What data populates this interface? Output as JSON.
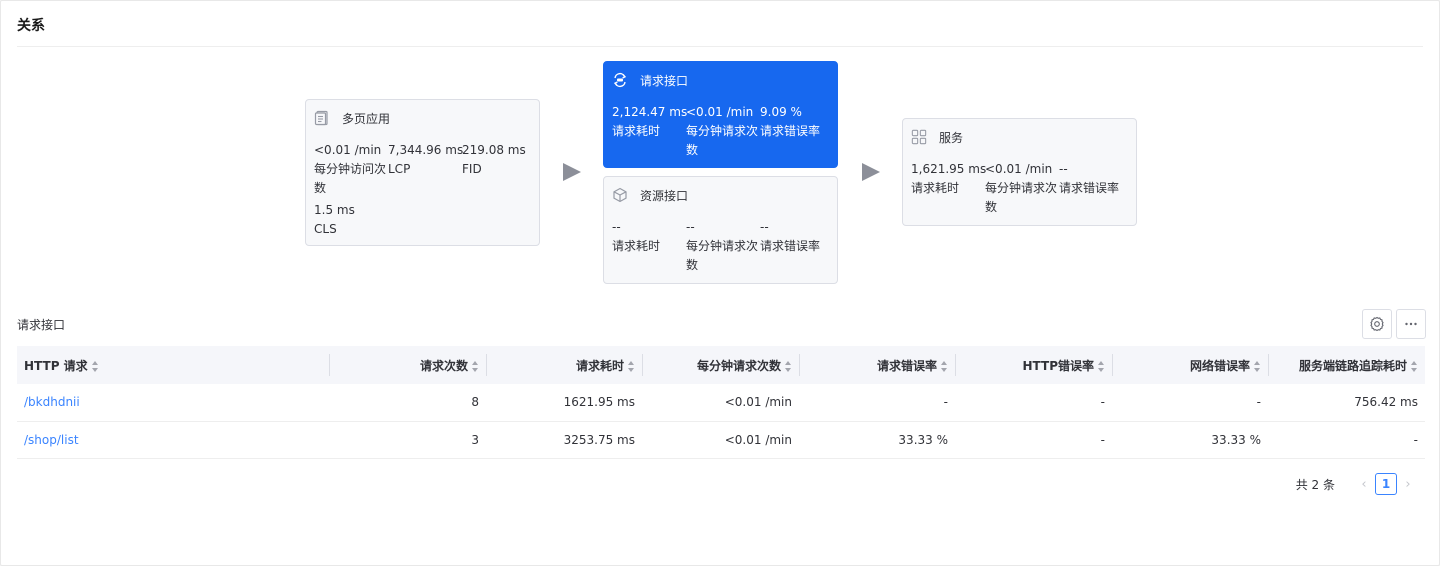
{
  "section_title": "关系",
  "cards": {
    "app": {
      "title": "多页应用",
      "icon": "document-icon",
      "metrics": [
        {
          "value": "<0.01 /min",
          "label": "每分钟访问次数"
        },
        {
          "value": "7,344.96 ms",
          "label": "LCP"
        },
        {
          "value": "219.08 ms",
          "label": "FID"
        },
        {
          "value": "1.5 ms",
          "label": "CLS"
        }
      ]
    },
    "request": {
      "title": "请求接口",
      "icon": "api-exchange-icon",
      "active": true,
      "metrics": [
        {
          "value": "2,124.47 ms",
          "label": "请求耗时"
        },
        {
          "value": "<0.01 /min",
          "label": "每分钟请求次数"
        },
        {
          "value": "9.09 %",
          "label": "请求错误率"
        }
      ]
    },
    "resource": {
      "title": "资源接口",
      "icon": "cube-icon",
      "metrics": [
        {
          "value": "--",
          "label": "请求耗时"
        },
        {
          "value": "--",
          "label": "每分钟请求次数"
        },
        {
          "value": "--",
          "label": "请求错误率"
        }
      ]
    },
    "service": {
      "title": "服务",
      "icon": "grid-icon",
      "metrics": [
        {
          "value": "1,621.95 ms",
          "label": "请求耗时"
        },
        {
          "value": "<0.01 /min",
          "label": "每分钟请求次数"
        },
        {
          "value": "--",
          "label": "请求错误率"
        }
      ]
    }
  },
  "table_section": {
    "title": "请求接口",
    "settings_icon": "settings-gear-icon",
    "more_icon": "more-horizontal-icon"
  },
  "table": {
    "columns": [
      "HTTP 请求",
      "请求次数",
      "请求耗时",
      "每分钟请求次数",
      "请求错误率",
      "HTTP错误率",
      "网络错误率",
      "服务端链路追踪耗时"
    ],
    "rows": [
      [
        "/bkdhdnii",
        "8",
        "1621.95 ms",
        "<0.01 /min",
        "-",
        "-",
        "-",
        "756.42 ms"
      ],
      [
        "/shop/list",
        "3",
        "3253.75 ms",
        "<0.01 /min",
        "33.33 %",
        "-",
        "33.33 %",
        "-"
      ]
    ]
  },
  "pagination": {
    "total_text": "共 2 条",
    "current_page": "1",
    "prev_icon": "chevron-left-icon",
    "next_icon": "chevron-right-icon"
  },
  "colors": {
    "accent": "#1768ef",
    "link": "#3a84ff",
    "card_bg": "#f7f8fa"
  }
}
